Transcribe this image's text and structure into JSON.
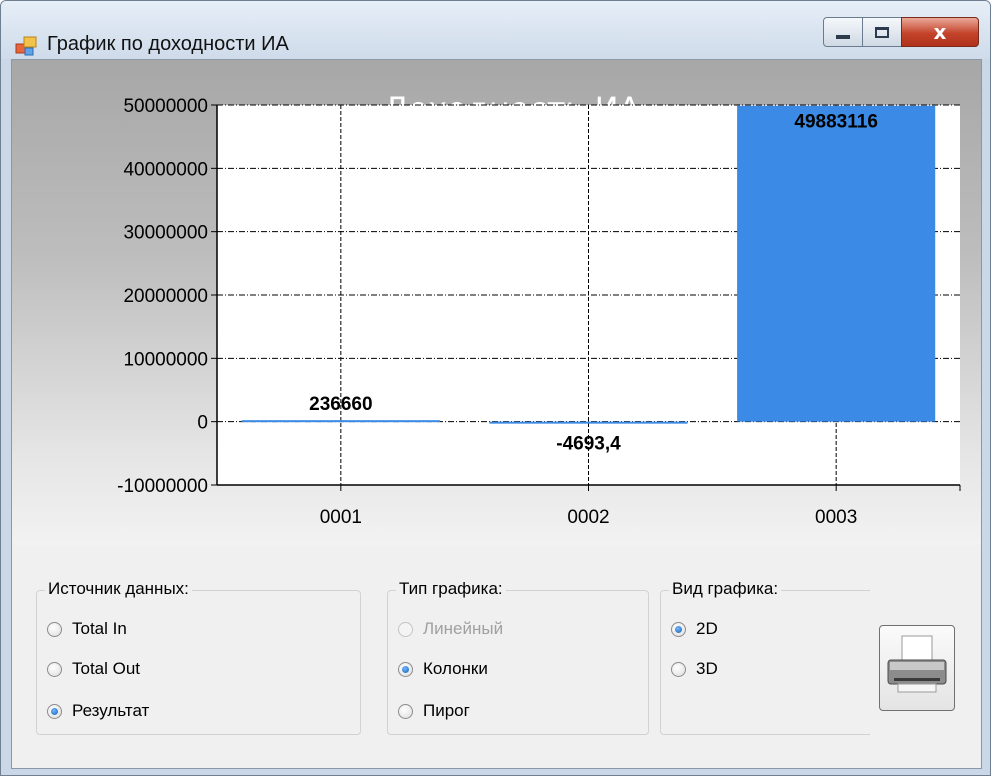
{
  "window": {
    "title": "График по доходности ИА",
    "close_glyph": "x"
  },
  "chart_data": {
    "type": "bar",
    "title": "Доходность ИА",
    "categories": [
      "0001",
      "0002",
      "0003"
    ],
    "values": [
      236660,
      -4693.4,
      49883116
    ],
    "value_labels": [
      "236660",
      "-4693,4",
      "49883116"
    ],
    "ylim": [
      -10000000,
      50000000
    ],
    "yticks": [
      50000000,
      40000000,
      30000000,
      20000000,
      10000000,
      0,
      -10000000
    ],
    "ytick_labels": [
      "50000000",
      "40000000",
      "30000000",
      "20000000",
      "10000000",
      "0",
      "-10000000"
    ],
    "grid": true,
    "bar_color": "#3b8ae6"
  },
  "controls": {
    "data_source": {
      "title": "Источник данных:",
      "options": [
        "Total In",
        "Total Out",
        "Результат"
      ],
      "selected": 2
    },
    "chart_type": {
      "title": "Тип графика:",
      "options": [
        "Линейный",
        "Колонки",
        "Пирог"
      ],
      "selected": 1,
      "disabled": [
        0
      ]
    },
    "chart_view": {
      "title": "Вид графика:",
      "options": [
        "2D",
        "3D"
      ],
      "selected": 0
    },
    "print_button_icon": "printer-icon"
  }
}
